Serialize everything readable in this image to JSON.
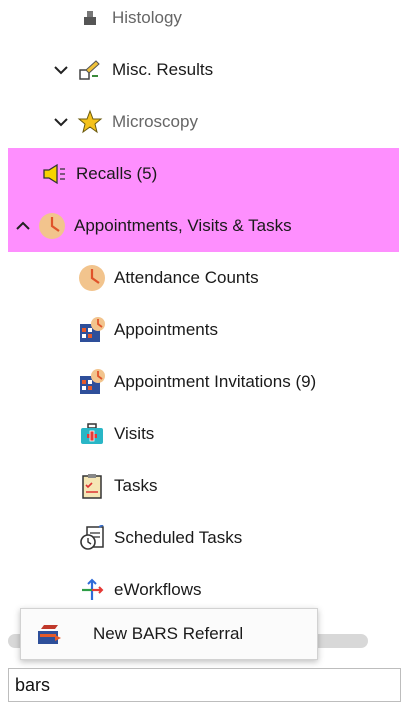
{
  "tree": {
    "items": [
      {
        "label": "Histology",
        "icon": "histology-icon"
      },
      {
        "label": "Misc. Results",
        "icon": "misc-results-icon",
        "chevron": "down"
      },
      {
        "label": "Microscopy",
        "icon": "microscopy-icon",
        "chevron": "down"
      },
      {
        "label": "Recalls (5)",
        "icon": "recalls-megaphone-icon",
        "highlighted": true
      },
      {
        "label": "Appointments, Visits & Tasks",
        "icon": "clock-icon",
        "chevron": "up",
        "highlighted": true
      },
      {
        "label": "Attendance Counts",
        "icon": "clock-icon"
      },
      {
        "label": "Appointments",
        "icon": "appointments-calendar-icon"
      },
      {
        "label": "Appointment Invitations (9)",
        "icon": "appointment-invitations-icon"
      },
      {
        "label": "Visits",
        "icon": "visits-medical-kit-icon"
      },
      {
        "label": "Tasks",
        "icon": "tasks-clipboard-icon"
      },
      {
        "label": "Scheduled Tasks",
        "icon": "scheduled-tasks-icon"
      },
      {
        "label": "eWorkflows",
        "icon": "eworkflows-icon"
      }
    ]
  },
  "popup": {
    "item_label": "New BARS Referral",
    "icon": "referral-icon"
  },
  "search": {
    "value": "bars"
  },
  "colors": {
    "highlight": "#fe8ffe"
  }
}
